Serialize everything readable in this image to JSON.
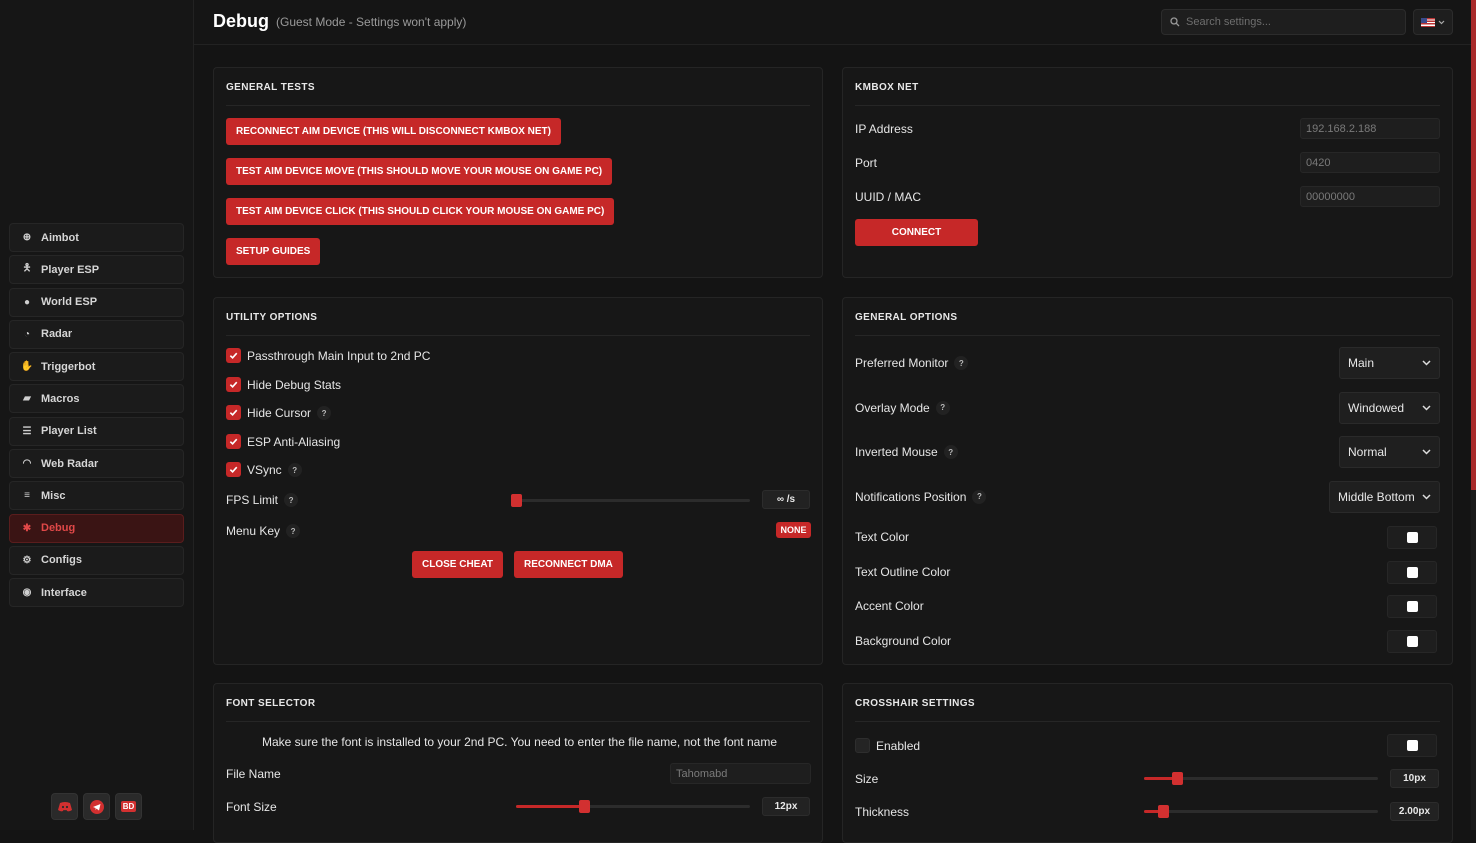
{
  "header": {
    "title": "Debug",
    "subtitle": "(Guest Mode - Settings won't apply)",
    "search_placeholder": "Search settings...",
    "language_icon": "us-flag-icon"
  },
  "sidebar": {
    "items": [
      {
        "label": "Aimbot",
        "icon": "crosshair-icon"
      },
      {
        "label": "Player ESP",
        "icon": "person-icon"
      },
      {
        "label": "World ESP",
        "icon": "globe-icon"
      },
      {
        "label": "Radar",
        "icon": "radar-icon"
      },
      {
        "label": "Triggerbot",
        "icon": "hand-icon"
      },
      {
        "label": "Macros",
        "icon": "gamepad-icon"
      },
      {
        "label": "Player List",
        "icon": "list-icon"
      },
      {
        "label": "Web Radar",
        "icon": "wifi-icon"
      },
      {
        "label": "Misc",
        "icon": "menu-icon"
      },
      {
        "label": "Debug",
        "icon": "bug-icon",
        "active": true
      },
      {
        "label": "Configs",
        "icon": "gear-icon"
      },
      {
        "label": "Interface",
        "icon": "palette-icon"
      }
    ],
    "social": [
      "discord-icon",
      "telegram-icon",
      "BD"
    ]
  },
  "general_tests": {
    "title": "GENERAL TESTS",
    "buttons": [
      "RECONNECT AIM DEVICE (THIS WILL DISCONNECT KMBOX NET)",
      "TEST AIM DEVICE MOVE (THIS SHOULD MOVE YOUR MOUSE ON GAME PC)",
      "TEST AIM DEVICE CLICK (THIS SHOULD CLICK YOUR MOUSE ON GAME PC)",
      "SETUP GUIDES"
    ]
  },
  "kmbox": {
    "title": "KMBOX NET",
    "ip_label": "IP Address",
    "ip_value": "192.168.2.188",
    "port_label": "Port",
    "port_value": "0420",
    "uuid_label": "UUID / MAC",
    "uuid_value": "00000000",
    "connect": "CONNECT"
  },
  "utility": {
    "title": "UTILITY OPTIONS",
    "options": [
      {
        "label": "Passthrough Main Input to 2nd PC",
        "checked": true,
        "help": false
      },
      {
        "label": "Hide Debug Stats",
        "checked": true,
        "help": false
      },
      {
        "label": "Hide Cursor",
        "checked": true,
        "help": true
      },
      {
        "label": "ESP Anti-Aliasing",
        "checked": true,
        "help": false
      },
      {
        "label": "VSync",
        "checked": true,
        "help": true
      }
    ],
    "fps_label": "FPS Limit",
    "fps_value": "∞ /s",
    "fps_level": 0,
    "menu_key_label": "Menu Key",
    "menu_key_value": "NONE",
    "close_cheat": "CLOSE CHEAT",
    "reconnect_dma": "RECONNECT DMA",
    "help": "?"
  },
  "general_options": {
    "title": "GENERAL OPTIONS",
    "selects": [
      {
        "label": "Preferred Monitor",
        "value": "Main"
      },
      {
        "label": "Overlay Mode",
        "value": "Windowed"
      },
      {
        "label": "Inverted Mouse",
        "value": "Normal"
      },
      {
        "label": "Notifications Position",
        "value": "Middle Bottom"
      }
    ],
    "colors": [
      {
        "label": "Text Color",
        "value": "#ffffff"
      },
      {
        "label": "Text Outline Color",
        "value": "#ffffff"
      },
      {
        "label": "Accent Color",
        "value": "#ffffff"
      },
      {
        "label": "Background Color",
        "value": "#ffffff"
      }
    ]
  },
  "font_selector": {
    "title": "FONT SELECTOR",
    "note": "Make sure the font is installed to your 2nd PC. You need to enter the file name, not the font name",
    "file_name_label": "File Name",
    "file_name_value": "Tahomabd",
    "font_size_label": "Font Size",
    "font_size_value": "12px",
    "font_size_level": 0.29
  },
  "crosshair": {
    "title": "CROSSHAIR SETTINGS",
    "enabled_label": "Enabled",
    "enabled": false,
    "size_label": "Size",
    "size_value": "10px",
    "size_level": 0.14,
    "thickness_label": "Thickness",
    "thickness_value": "2.00px",
    "thickness_level": 0.08
  },
  "colors": {
    "accent": "#c62828",
    "background": "#141414",
    "panel": "#171717"
  }
}
